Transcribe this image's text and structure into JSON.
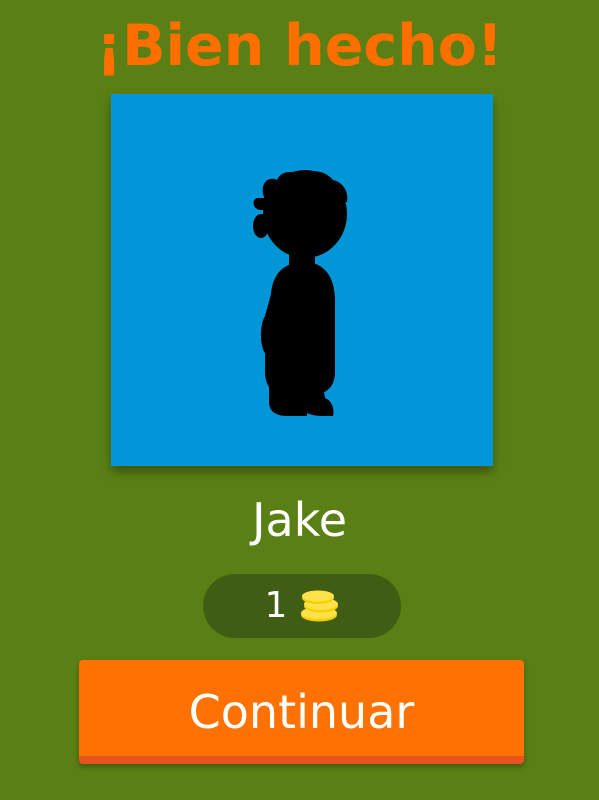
{
  "result": {
    "title": "¡Bien hecho!"
  },
  "character": {
    "icon": "boy-silhouette-icon",
    "background_color": "#0096d8",
    "answer": "Jake"
  },
  "reward": {
    "coins": "1",
    "icon": "coin-stack-icon"
  },
  "actions": {
    "continue_label": "Continuar"
  },
  "colors": {
    "background": "#5a8015",
    "title": "#ff6f00",
    "button": "#ff7100",
    "coin_pill": "#3f5e14",
    "coin": "#f7d000"
  }
}
